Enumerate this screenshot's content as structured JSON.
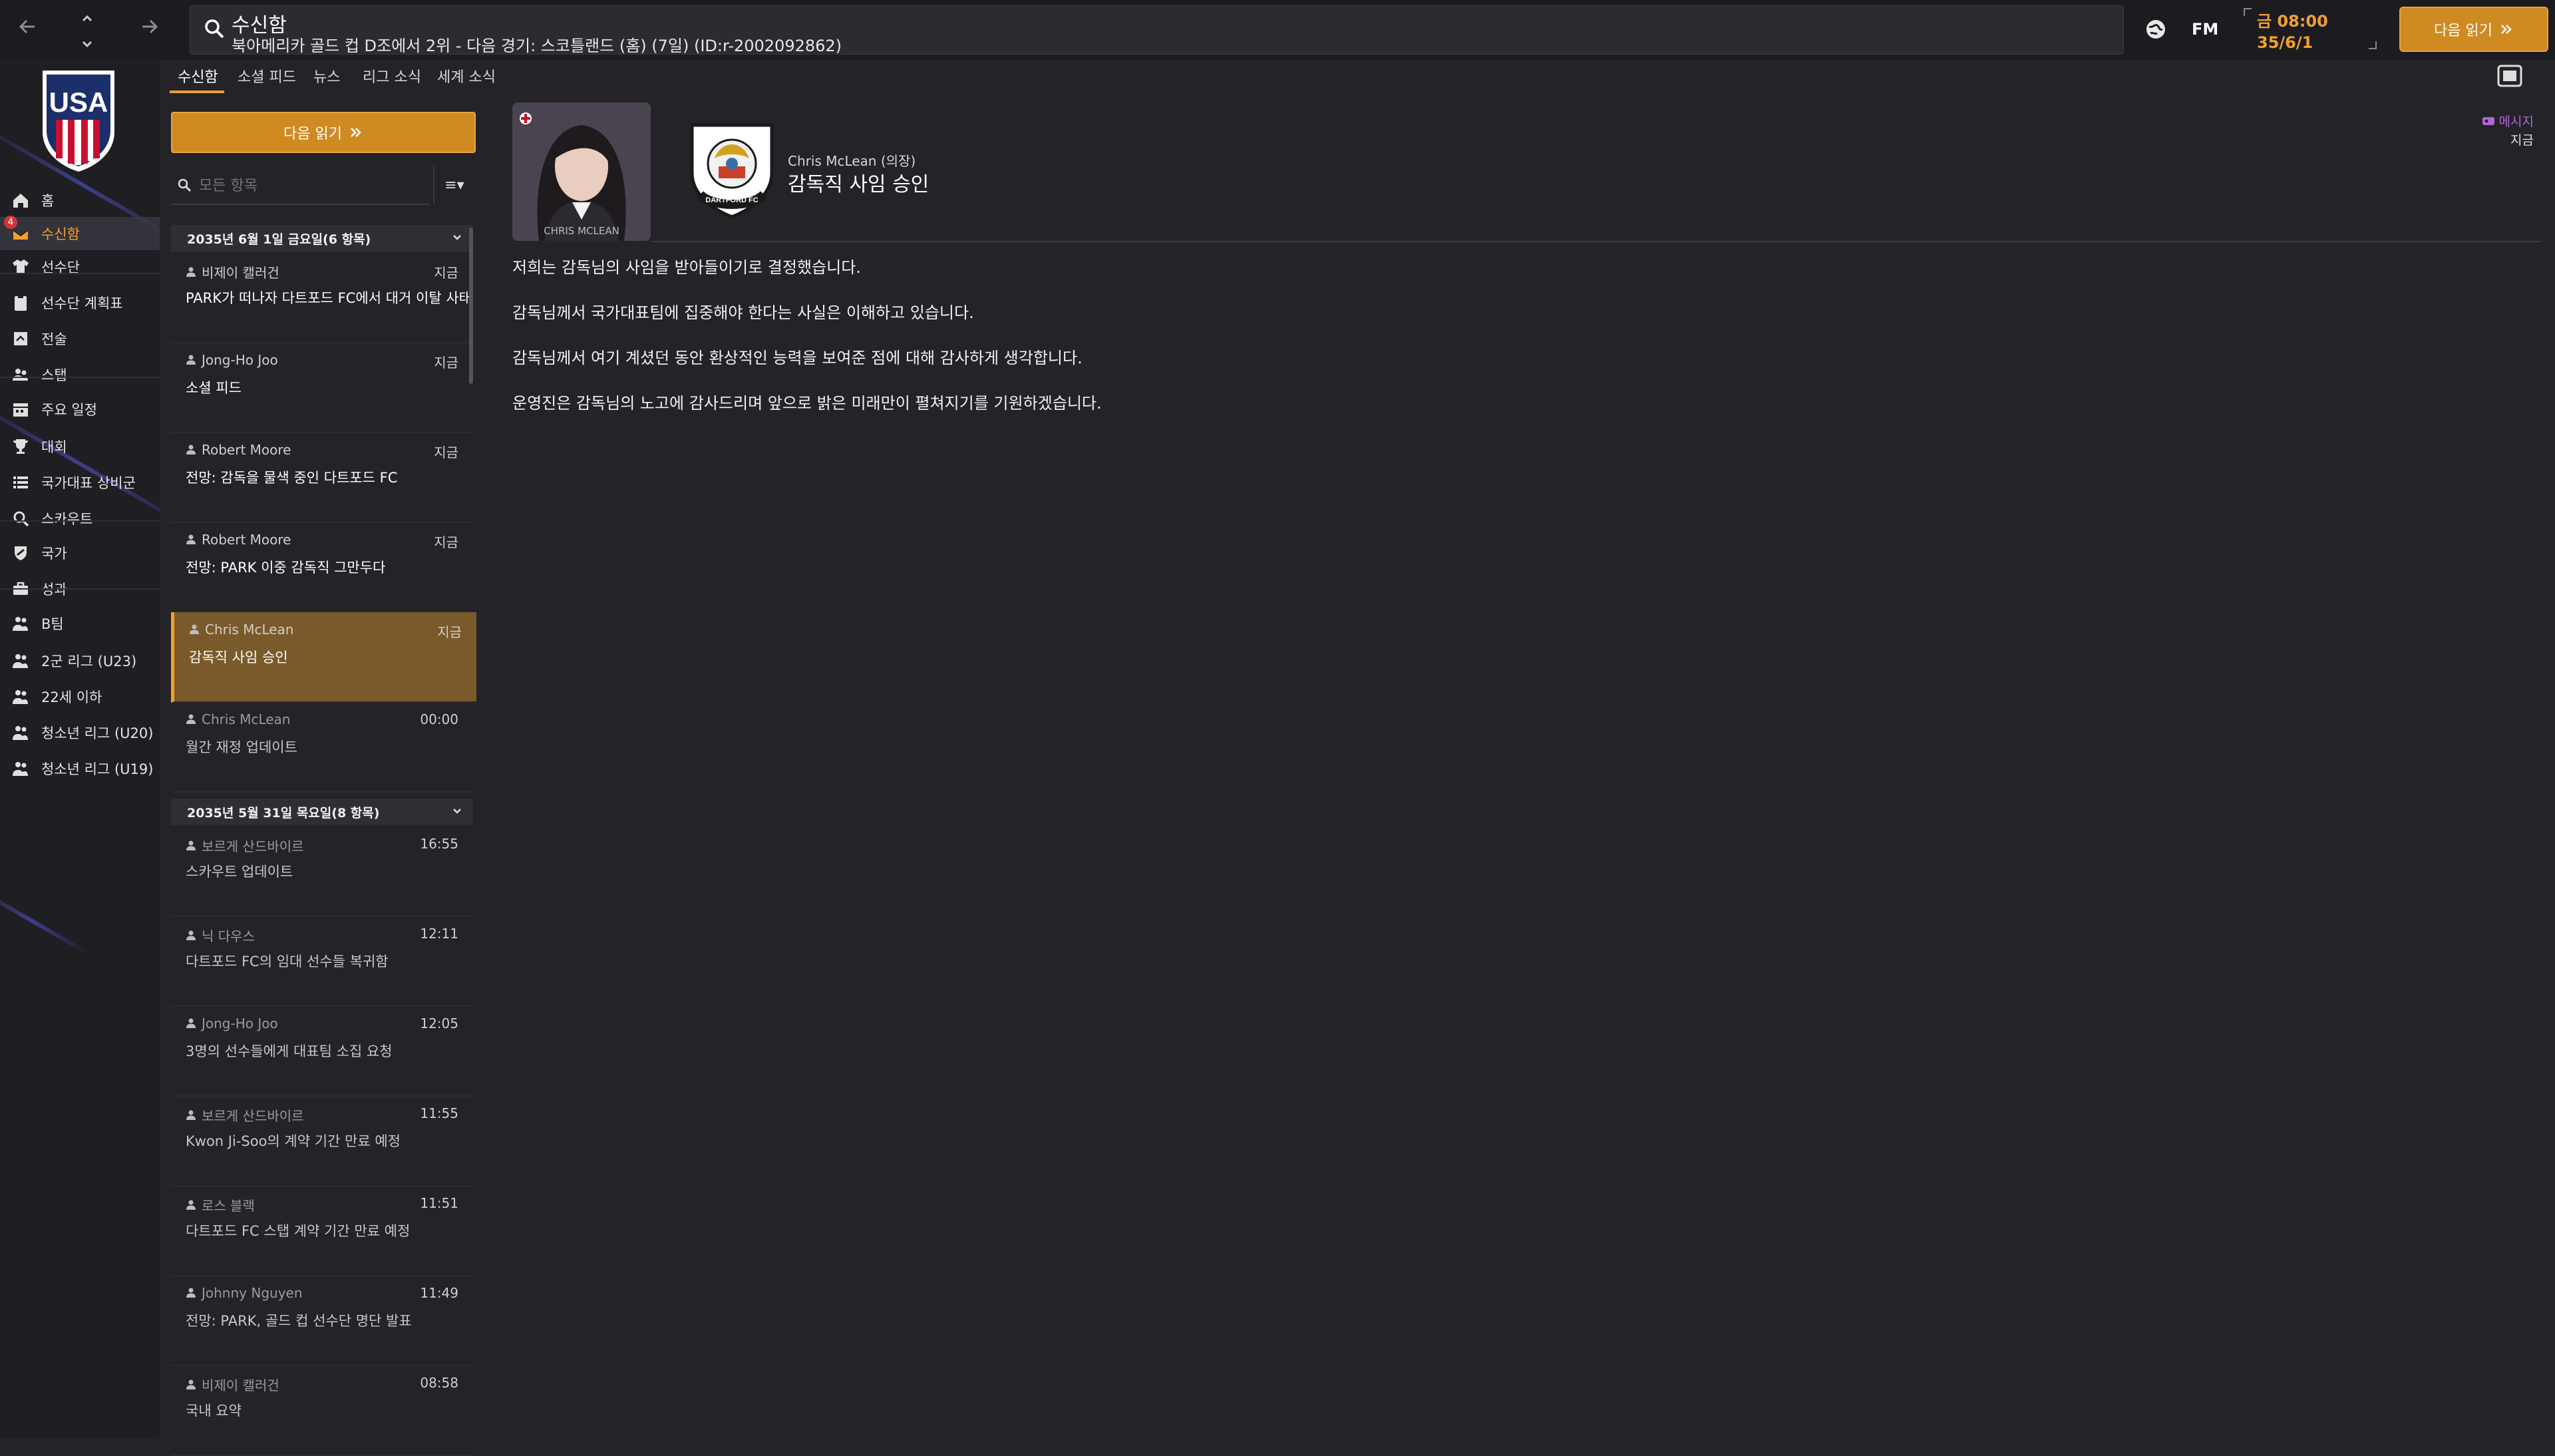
{
  "topbar": {
    "back_icon": "arrow-left-icon",
    "forward_icon": "arrow-right-icon",
    "up_icon": "chevron-up-icon",
    "down_icon": "chevron-down-icon",
    "search_title": "수신함",
    "search_subtitle": "북아메리카 골드 컵 D조에서 2위 - 다음 경기: 스코틀랜드 (홈) (7일) (ID:r-2002092862)",
    "fm_label": "FM",
    "time": "금 08:00",
    "date": "35/6/1",
    "continue_label": "다음 읽기",
    "accent_color": "#f0a030"
  },
  "sidebar": {
    "items": [
      {
        "label": "홈",
        "icon": "home-icon"
      },
      {
        "label": "수신함",
        "icon": "inbox-icon",
        "active": true,
        "badge": "4"
      },
      {
        "label": "선수단",
        "icon": "shirt-icon"
      },
      {
        "label": "선수단 계획표",
        "icon": "clipboard-icon"
      },
      {
        "label": "전술",
        "icon": "tactics-icon"
      },
      {
        "label": "스탭",
        "icon": "staff-icon"
      },
      {
        "label": "주요 일정",
        "icon": "calendar-icon"
      },
      {
        "label": "대회",
        "icon": "trophy-icon"
      },
      {
        "label": "국가대표 상비군",
        "icon": "list-icon"
      },
      {
        "label": "스카우트",
        "icon": "magnifier-icon"
      },
      {
        "label": "국가",
        "icon": "shield-icon"
      },
      {
        "label": "성과",
        "icon": "briefcase-icon"
      },
      {
        "label": "B팀",
        "icon": "team-icon"
      },
      {
        "label": "2군 리그 (U23)",
        "icon": "team-icon"
      },
      {
        "label": "22세 이하",
        "icon": "team-icon"
      },
      {
        "label": "청소년 리그 (U20)",
        "icon": "team-icon"
      },
      {
        "label": "청소년 리그 (U19)",
        "icon": "team-icon"
      }
    ]
  },
  "inbox": {
    "tabs": [
      "수신함",
      "소셜 피드",
      "뉴스",
      "리그 소식",
      "세계 소식"
    ],
    "continue_label": "다음 읽기",
    "filter_placeholder": "모든 항목",
    "filter_menu": "≡▾",
    "groups": [
      {
        "header": "2035년 6월 1일 금요일(6 항목)",
        "messages": [
          {
            "sender": "비제이 캘러건",
            "time": "지금",
            "subject": "PARK가 떠나자 다트포드 FC에서 대거 이탈 사태",
            "read": false
          },
          {
            "sender": "Jong-Ho Joo",
            "time": "지금",
            "subject": "소셜 피드",
            "read": false
          },
          {
            "sender": "Robert Moore",
            "time": "지금",
            "subject": "전망: 감독을 물색 중인 다트포드 FC",
            "read": false
          },
          {
            "sender": "Robert Moore",
            "time": "지금",
            "subject": "전망: PARK 이중 감독직 그만두다",
            "read": false
          },
          {
            "sender": "Chris McLean",
            "time": "지금",
            "subject": "감독직 사임 승인",
            "read": false,
            "active": true
          },
          {
            "sender": "Chris McLean",
            "time": "00:00",
            "subject": "월간 재정 업데이트",
            "read": true
          }
        ]
      },
      {
        "header": "2035년 5월 31일 목요일(8 항목)",
        "messages": [
          {
            "sender": "보르게 산드바이르",
            "time": "16:55",
            "subject": "스카우트 업데이트",
            "read": true
          },
          {
            "sender": "닉 다우스",
            "time": "12:11",
            "subject": "다트포드 FC의 임대 선수들 복귀함",
            "read": true
          },
          {
            "sender": "Jong-Ho Joo",
            "time": "12:05",
            "subject": "3명의 선수들에게 대표팀 소집 요청",
            "read": true
          },
          {
            "sender": "보르게 산드바이르",
            "time": "11:55",
            "subject": "Kwon Ji-Soo의 계약 기간 만료 예정",
            "read": true
          },
          {
            "sender": "로스 블랙",
            "time": "11:51",
            "subject": "다트포드 FC 스탭 계약 기간 만료 예정",
            "read": true
          },
          {
            "sender": "Johnny Nguyen",
            "time": "11:49",
            "subject": "전망: PARK, 골드 컵 선수단 명단 발표",
            "read": true
          },
          {
            "sender": "비제이 캘러건",
            "time": "08:58",
            "subject": "국내 요약",
            "read": true
          }
        ]
      }
    ]
  },
  "message": {
    "portrait_caption": "CHRIS MCLEAN",
    "crest_text": "DARTFORD FC",
    "from": "Chris McLean (의장)",
    "subject": "감독직 사임 승인",
    "tag": "메시지",
    "tag_time": "지금",
    "tag_color": "#b266d8",
    "body": [
      "저희는 감독님의 사임을 받아들이기로 결정했습니다.",
      "감독님께서 국가대표팀에 집중해야 한다는 사실은 이해하고 있습니다.",
      "감독님께서 여기 계셨던 동안 환상적인 능력을 보여준 점에 대해 감사하게 생각합니다.",
      "운영진은 감독님의 노고에 감사드리며 앞으로 밝은 미래만이 펼쳐지기를 기원하겠습니다."
    ]
  }
}
